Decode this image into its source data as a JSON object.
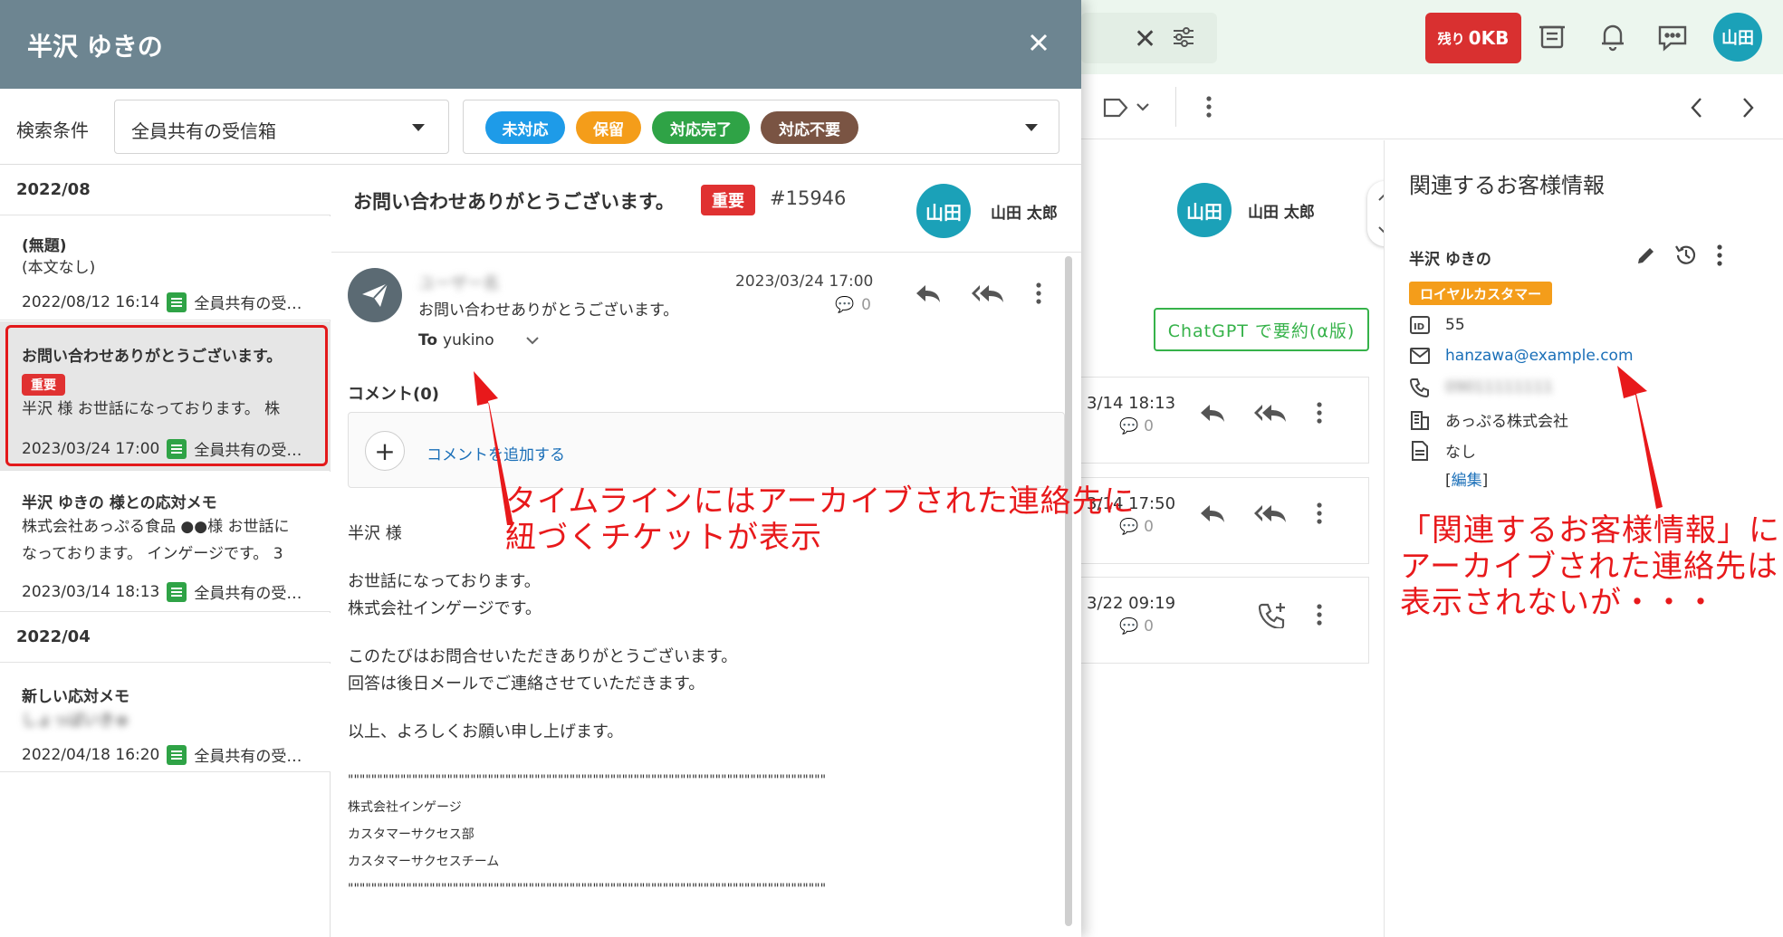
{
  "topbar": {
    "quota_prefix": "残り",
    "quota_value": "0KB",
    "user_avatar": "山田",
    "icons": [
      "close-icon",
      "filter-settings-icon",
      "archive-inbox-icon",
      "bell-icon",
      "chat-bubble-icon"
    ]
  },
  "background": {
    "assignee_avatar": "山田",
    "assignee_name": "山田 太郎",
    "chatgpt_button": "ChatGPT で要約(α版)",
    "timeline": [
      {
        "date": "3/14 18:13",
        "count": "0"
      },
      {
        "date": "3/14 17:50",
        "count": "0"
      },
      {
        "date": "3/22 09:19",
        "count": "0"
      }
    ]
  },
  "related_panel": {
    "title": "関連するお客様情報",
    "customer_name": "半沢 ゆきの",
    "badge": "ロイヤルカスタマー",
    "id": "55",
    "email": "hanzawa@example.com",
    "phone": "09011111111",
    "company": "あっぷる株式会社",
    "note": "なし",
    "edit_open": "[",
    "edit_label": "編集",
    "edit_close": "]"
  },
  "modal": {
    "title": "半沢 ゆきの",
    "filter_label": "検索条件",
    "inbox_select": "全員共有の受信箱",
    "statuses": [
      {
        "label": "未対応",
        "color": "#1e9be8"
      },
      {
        "label": "保留",
        "color": "#f49d1a"
      },
      {
        "label": "対応完了",
        "color": "#2fa346"
      },
      {
        "label": "対応不要",
        "color": "#7a5443"
      }
    ]
  },
  "list": {
    "groups": [
      {
        "label": "2022/08"
      },
      {
        "label": "2022/04"
      }
    ],
    "items": [
      {
        "title": "(無題)",
        "body": "(本文なし)",
        "date": "2022/08/12 16:14",
        "inbox": "全員共有の受…"
      },
      {
        "title": "お問い合わせありがとうございます。",
        "tag": "重要",
        "body": "半沢 様 お世話になっております。 株",
        "date": "2023/03/24 17:00",
        "inbox": "全員共有の受…"
      },
      {
        "title": "半沢 ゆきの 様との応対メモ",
        "body": "株式会社あっぷる食品 ●●様 お世話に",
        "body2": "なっております。 インゲージです。 3",
        "date": "2023/03/14 18:13",
        "inbox": "全員共有の受…"
      },
      {
        "title": "新しい応対メモ",
        "body": "しょっぱいきゅ",
        "date": "2022/04/18 16:20",
        "inbox": "全員共有の受…"
      }
    ]
  },
  "detail": {
    "subject": "お問い合わせありがとうございます。",
    "importance": "重要",
    "ticket_no": "#15946",
    "assignee_avatar": "山田",
    "assignee_name": "山田 太郎",
    "message": {
      "sender": "ユーザー名",
      "snippet": "お問い合わせありがとうございます。",
      "to_label": "To",
      "to_value": "yukino",
      "date": "2023/03/24 17:00",
      "comment_count": "0"
    },
    "comment_label": "コメント(0)",
    "add_comment": "コメントを追加する",
    "body": [
      "半沢 様",
      "お世話になっております。\n株式会社インゲージです。",
      "このたびはお問合せいただきありがとうございます。\n回答は後日メールでご連絡させていただきます。",
      "以上、よろしくお願い申し上げます。",
      "\"\"\"\"\"\"\"\"\"\"\"\"\"\"\"\"\"\"\"\"\"\"\"\"\"\"\"\"\"\"\"\"\"\"\"\"\"\"\"\"\"\"\"\"\"\"\"\"\"\"\"\"\"\"\"\"\"\"\"\"\"\"\"\"\"\"\"\"\"\"\"\"\"\"\"\"\"\"\"\"\"\"\n株式会社インゲージ\nカスタマーサクセス部\nカスタマーサクセスチーム\n\"\"\"\"\"\"\"\"\"\"\"\"\"\"\"\"\"\"\"\"\"\"\"\"\"\"\"\"\"\"\"\"\"\"\"\"\"\"\"\"\"\"\"\"\"\"\"\"\"\"\"\"\"\"\"\"\"\"\"\"\"\"\"\"\"\"\"\"\"\"\"\"\"\"\"\"\"\"\"\"\"\""
    ]
  },
  "annotations": {
    "left_line1": "タイムラインにはアーカイブされた連絡先に",
    "left_line2": "紐づくチケットが表示",
    "right_line1": "「関連するお客様情報」に",
    "right_line2": "アーカイブされた連絡先は",
    "right_line3": "表示されないが・・・",
    "color": "#e8191b"
  }
}
